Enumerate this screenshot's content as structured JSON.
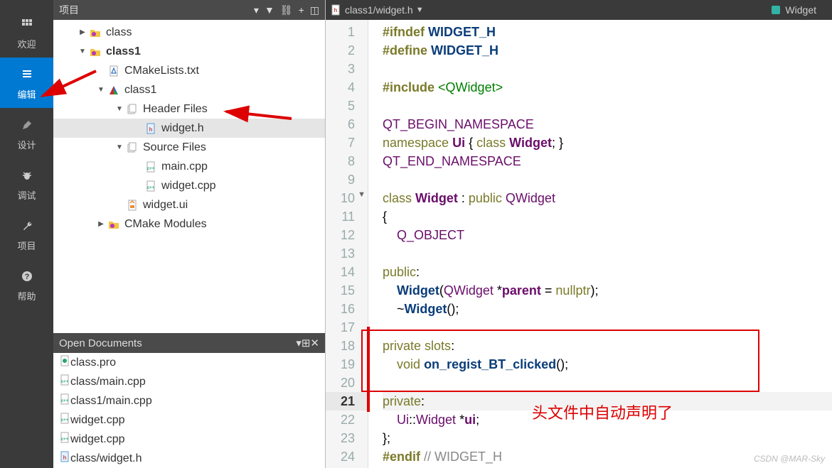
{
  "leftbar": {
    "items": [
      {
        "label": "欢迎",
        "icon": "grid-icon"
      },
      {
        "label": "编辑",
        "icon": "lines-icon",
        "active": true
      },
      {
        "label": "设计",
        "icon": "pencil-icon"
      },
      {
        "label": "调试",
        "icon": "bug-icon"
      },
      {
        "label": "项目",
        "icon": "wrench-icon"
      },
      {
        "label": "帮助",
        "icon": "help-icon"
      }
    ]
  },
  "project_panel": {
    "title": "项目",
    "tree": [
      {
        "indent": 1,
        "twist": "▶",
        "icon": "folder-gear",
        "label": "class",
        "bold": false
      },
      {
        "indent": 1,
        "twist": "▼",
        "icon": "folder-gear",
        "label": "class1",
        "bold": true
      },
      {
        "indent": 2,
        "twist": "",
        "icon": "cmake",
        "label": "CMakeLists.txt"
      },
      {
        "indent": 2,
        "twist": "▼",
        "icon": "cmake-tri",
        "label": "class1"
      },
      {
        "indent": 3,
        "twist": "▼",
        "icon": "folder-pages",
        "label": "Header Files"
      },
      {
        "indent": 4,
        "twist": "",
        "icon": "h-file",
        "label": "widget.h",
        "sel": true
      },
      {
        "indent": 3,
        "twist": "▼",
        "icon": "folder-pages",
        "label": "Source Files"
      },
      {
        "indent": 4,
        "twist": "",
        "icon": "cpp-file",
        "label": "main.cpp"
      },
      {
        "indent": 4,
        "twist": "",
        "icon": "cpp-file",
        "label": "widget.cpp"
      },
      {
        "indent": 3,
        "twist": "",
        "icon": "ui-file",
        "label": "widget.ui"
      },
      {
        "indent": 2,
        "twist": "▶",
        "icon": "folder-gear",
        "label": "CMake Modules"
      }
    ]
  },
  "open_docs": {
    "title": "Open Documents",
    "items": [
      {
        "icon": "pro-file",
        "label": "class.pro"
      },
      {
        "icon": "cpp-file",
        "label": "class/main.cpp"
      },
      {
        "icon": "cpp-file",
        "label": "class1/main.cpp"
      },
      {
        "icon": "cpp-file",
        "label": "widget.cpp"
      },
      {
        "icon": "cpp-file",
        "label": "widget.cpp"
      },
      {
        "icon": "h-file",
        "label": "class/widget.h"
      }
    ]
  },
  "tabs": {
    "file": "class1/widget.h",
    "symbol": "Widget"
  },
  "code": {
    "lines": [
      {
        "n": 1,
        "html": "<span class='kw'>#ifndef</span> <span class='mac'>WIDGET_H</span>"
      },
      {
        "n": 2,
        "html": "<span class='kw'>#define</span> <span class='mac'>WIDGET_H</span>"
      },
      {
        "n": 3,
        "html": ""
      },
      {
        "n": 4,
        "html": "<span class='kw'>#include</span> <span class='inc'>&lt;QWidget&gt;</span>"
      },
      {
        "n": 5,
        "html": ""
      },
      {
        "n": 6,
        "html": "<span class='type'>QT_BEGIN_NAMESPACE</span>"
      },
      {
        "n": 7,
        "html": "<span class='kw2'>namespace</span> <span class='typeb'>Ui</span> { <span class='kw2'>class</span> <span class='typeb'>Widget</span>; }"
      },
      {
        "n": 8,
        "html": "<span class='type'>QT_END_NAMESPACE</span>"
      },
      {
        "n": 9,
        "html": ""
      },
      {
        "n": 10,
        "html": "<span class='kw2'>class</span> <span class='typeb'>Widget</span> : <span class='kw2'>public</span> <span class='type'>QWidget</span>",
        "fold": true
      },
      {
        "n": 11,
        "html": "{"
      },
      {
        "n": 12,
        "html": "    <span class='type'>Q_OBJECT</span>"
      },
      {
        "n": 13,
        "html": ""
      },
      {
        "n": 14,
        "html": "<span class='kw2'>public</span>:"
      },
      {
        "n": 15,
        "html": "    <span class='fn'>Widget</span>(<span class='type'>QWidget</span> *<span class='typeb'>parent</span> = <span class='kw2'>nullptr</span>);"
      },
      {
        "n": 16,
        "html": "    ~<span class='fn'>Widget</span>();"
      },
      {
        "n": 17,
        "html": ""
      },
      {
        "n": 18,
        "html": "<span class='kw2'>private</span> <span class='kw2'>slots</span>:"
      },
      {
        "n": 19,
        "html": "    <span class='kw2'>void</span> <span class='fn'>on_regist_BT_clicked</span>();"
      },
      {
        "n": 20,
        "html": ""
      },
      {
        "n": 21,
        "html": "<span class='kw2'>private</span>:",
        "cur": true
      },
      {
        "n": 22,
        "html": "    <span class='type'>Ui</span>::<span class='type'>Widget</span> *<span class='typeb'>ui</span>;"
      },
      {
        "n": 23,
        "html": "};"
      },
      {
        "n": 24,
        "html": "<span class='kw'>#endif</span> <span class='cmt'>// WIDGET_H</span>"
      }
    ]
  },
  "annotation": {
    "text": "头文件中自动声明了",
    "watermark": "CSDN @MAR-Sky"
  }
}
